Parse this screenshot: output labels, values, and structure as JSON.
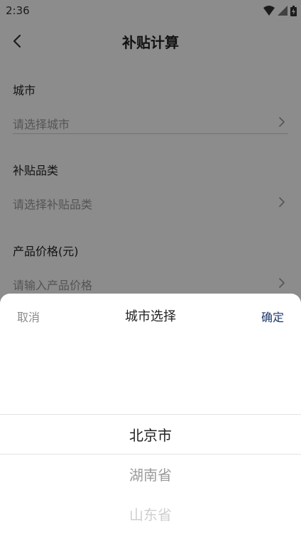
{
  "status_bar": {
    "time": "2:36"
  },
  "app_bar": {
    "title": "补贴计算"
  },
  "form": {
    "city": {
      "label": "城市",
      "placeholder": "请选择城市"
    },
    "category": {
      "label": "补贴品类",
      "placeholder": "请选择补贴品类"
    },
    "price": {
      "label": "产品价格(元)",
      "placeholder": "请输入产品价格"
    }
  },
  "sheet": {
    "cancel_label": "取消",
    "title": "城市选择",
    "confirm_label": "确定",
    "options": [
      "北京市",
      "湖南省",
      "山东省"
    ],
    "selected": "北京市"
  },
  "colors": {
    "confirm": "#1e3a6d",
    "overlay": "#000000"
  }
}
